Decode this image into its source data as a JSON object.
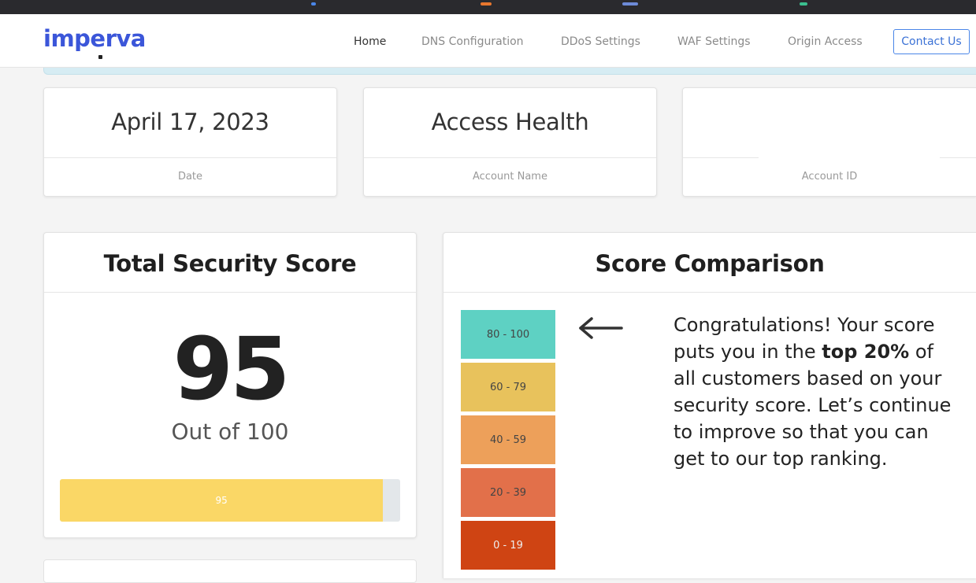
{
  "brand": {
    "logo_text": "imperva"
  },
  "nav": {
    "items": [
      {
        "label": "Home",
        "active": true
      },
      {
        "label": "DNS Configuration",
        "active": false
      },
      {
        "label": "DDoS Settings",
        "active": false
      },
      {
        "label": "WAF Settings",
        "active": false
      },
      {
        "label": "Origin Access",
        "active": false
      }
    ],
    "contact_label": "Contact Us"
  },
  "info_cards": [
    {
      "value": "April 17, 2023",
      "label": "Date"
    },
    {
      "value": "Access Health",
      "label": "Account Name"
    },
    {
      "value": "",
      "label": "Account ID"
    }
  ],
  "security_score": {
    "title": "Total Security Score",
    "score": "95",
    "out_of": "Out of 100",
    "progress_label": "95",
    "progress_percent": 95
  },
  "comparison": {
    "title": "Score Comparison",
    "tiers": [
      {
        "label": "80 - 100",
        "color": "#5ed1c3"
      },
      {
        "label": "60 - 79",
        "color": "#e8c25c"
      },
      {
        "label": "40 - 59",
        "color": "#eda05a"
      },
      {
        "label": "20 - 39",
        "color": "#e2704a"
      },
      {
        "label": "0 - 19",
        "color": "#cf4413"
      }
    ],
    "message_pre": "Congratulations! Your score puts you in the",
    "message_bold": "top 20%",
    "message_post": "of all customers based on your security score. Let’s continue to improve so that you can get to our top ranking."
  },
  "colors": {
    "brand": "#3b56d9",
    "accent": "#4a86e8",
    "progress": "#fad766"
  }
}
